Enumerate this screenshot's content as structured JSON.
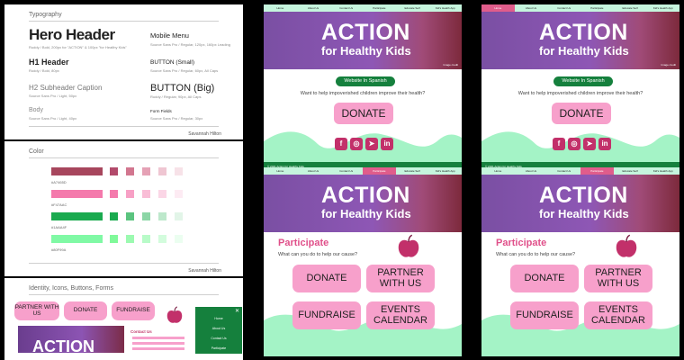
{
  "typography": {
    "title": "Typography",
    "hero": {
      "label": "Hero Header",
      "note": "Ruddy / Bold, 200px for \"ACTION\" & 100px \"for Healthy Kids\""
    },
    "h1": {
      "label": "H1 Header",
      "note": "Ruddy / Bold, 80px"
    },
    "h2": {
      "label": "H2 Subheader Caption",
      "note": "Source Sans Pro / Light, 50px"
    },
    "body": {
      "label": "Body",
      "note": "Source Sans Pro / Light, 40px"
    },
    "mobile_menu": {
      "label": "Mobile Menu",
      "note": "Source Sans Pro / Regular, 120px, 160px Leading"
    },
    "button_small": {
      "label": "BUTTON (Small)",
      "note": "Source Sans Pro / Regular, 60px, All Caps"
    },
    "button_big": {
      "label": "BUTTON (Big)",
      "note": "Ruddy / Regular, 90px, All Caps"
    },
    "form_fields": {
      "label": "Form Fields",
      "note": "Source Sans Pro / Regular, 30px"
    },
    "footer": "Savannah Hilton"
  },
  "color": {
    "title": "Color",
    "swatches": [
      {
        "hex": "#A7465D",
        "label": "#A7465D",
        "tints": [
          "#b24a6b",
          "#d2768f",
          "#e5a1b5",
          "#efc6d2",
          "#f7e2e8"
        ]
      },
      {
        "hex": "#F47AAC",
        "label": "#F47AAC",
        "tints": [
          "#f47aac",
          "#f7a0c5",
          "#f9bdd6",
          "#fbd6e6",
          "#fdebf3"
        ]
      },
      {
        "hex": "#1AAA4F",
        "label": "#1AAA4F",
        "tints": [
          "#1aaa4f",
          "#5bc47f",
          "#8cd6a6",
          "#bde8cb",
          "#e2f5e8"
        ]
      },
      {
        "hex": "#80F9A5",
        "label": "#80F99A",
        "tints": [
          "#80f99a",
          "#9cfab1",
          "#b8fbc8",
          "#d3fcdd",
          "#ebfef0"
        ]
      }
    ],
    "footer": "Savannah Hilton"
  },
  "components": {
    "title": "Identity, Icons, Buttons, Forms",
    "buttons": [
      "PARTNER WITH US",
      "DONATE",
      "FUNDRAISE"
    ],
    "hero_text": "ACTION",
    "form_label": "Contact Us",
    "menu_items": [
      "Home",
      "About Us",
      "Contact Us",
      "Participate"
    ],
    "menu_close": "✕"
  },
  "site": {
    "nav": [
      "Home",
      "About Us",
      "Contact Us",
      "Participate",
      "Educate Self",
      "Kid's Health App"
    ],
    "title": "ACTION",
    "subtitle": "for Healthy Kids",
    "hero_caption": "Image credit",
    "spanish_button": "Website In Spanish",
    "question": "Want to help impoverished children improve their health?",
    "donate": "DONATE",
    "social": [
      "f",
      "◎",
      "➤",
      "in"
    ],
    "footer_text": "© 2021 Action for Healthy Kids",
    "participate": {
      "title": "Participate",
      "question": "What can you do to help our cause?",
      "buttons": [
        "DONATE",
        "PARTNER WITH US",
        "FUNDRAISE",
        "EVENTS CALENDAR"
      ]
    }
  },
  "colors": {
    "pink": "#F7A0CB",
    "green": "#15803D",
    "mint": "#C5F5DD",
    "magenta": "#E05D8B",
    "apple": "#C2306A"
  }
}
